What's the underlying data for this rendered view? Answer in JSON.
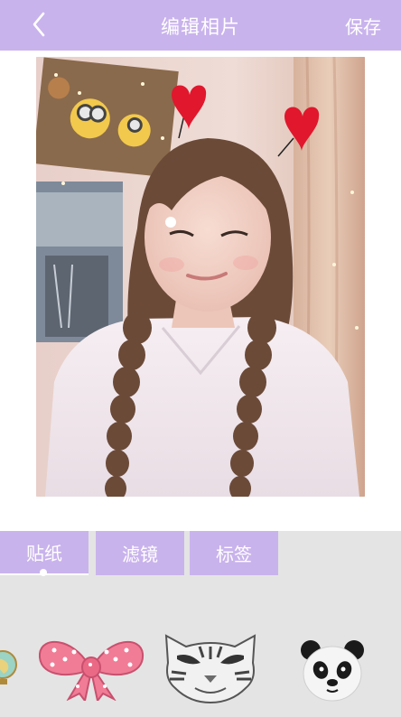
{
  "header": {
    "title": "编辑相片",
    "save_label": "保存",
    "back_icon": "chevron-left-icon",
    "background_color": "#c9b3ec"
  },
  "tabs": [
    {
      "label": "贴纸",
      "active": true
    },
    {
      "label": "滤镜",
      "active": false
    },
    {
      "label": "标签",
      "active": false
    }
  ],
  "stickers": [
    {
      "name": "globe-sticker",
      "icon": "globe-icon"
    },
    {
      "name": "pink-bow-sticker",
      "icon": "bow-icon"
    },
    {
      "name": "tiger-mask-sticker",
      "icon": "tiger-mask-icon"
    },
    {
      "name": "panda-sticker",
      "icon": "panda-icon"
    }
  ],
  "colors": {
    "accent": "#c9b3ec",
    "tray_background": "#e4e4e4",
    "heart_red": "#e0172d",
    "bow_pink": "#f07c96"
  }
}
